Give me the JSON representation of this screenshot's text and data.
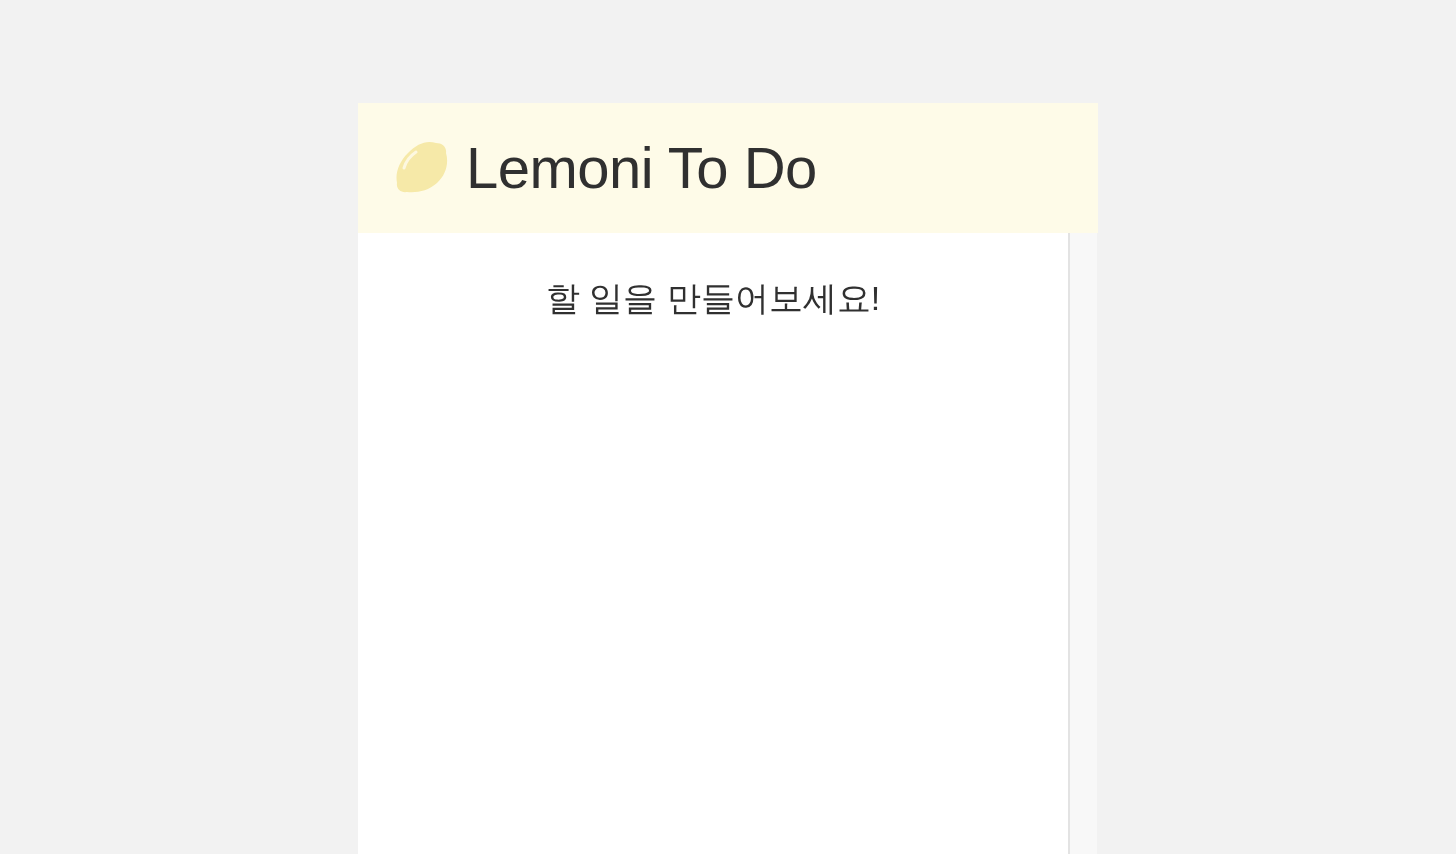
{
  "header": {
    "title": "Lemoni To Do"
  },
  "empty_message": "할 일을 만들어보세요!"
}
